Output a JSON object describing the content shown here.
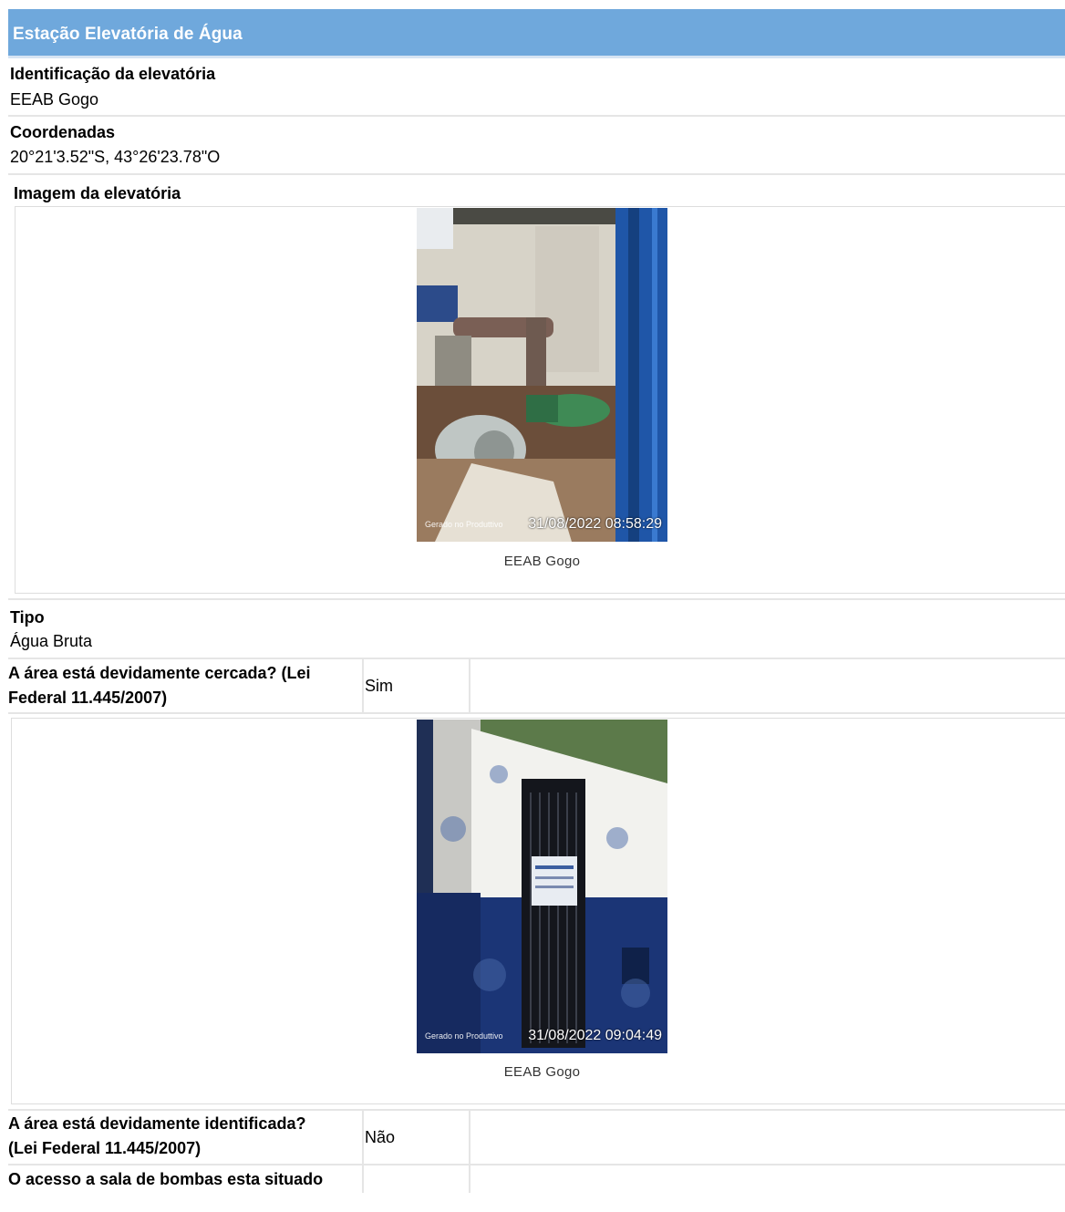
{
  "header": {
    "title": "Estação Elevatória de Água"
  },
  "identificacao": {
    "label": "Identificação da elevatória",
    "value": "EEAB Gogo"
  },
  "coordenadas": {
    "label": "Coordenadas",
    "value": "20°21'3.52\"S, 43°26'23.78\"O"
  },
  "imagem": {
    "label": "Imagem da elevatória",
    "photo_source": "Gerado no Produttivo",
    "photo_timestamp": "31/08/2022 08:58:29",
    "caption": "EEAB Gogo"
  },
  "tipo": {
    "label": "Tipo",
    "value": "Água Bruta"
  },
  "questions": [
    {
      "label_line1": "A área está devidamente cercada? (Lei",
      "label_line2": "Federal 11.445/2007)",
      "answer": "Sim",
      "photo_source": "Gerado no Produttivo",
      "photo_timestamp": "31/08/2022 09:04:49",
      "caption": "EEAB Gogo"
    },
    {
      "label_line1": "A área está devidamente identificada?",
      "label_line2": "(Lei Federal 11.445/2007)",
      "answer": "Não"
    },
    {
      "label_line1": "O acesso a sala de bombas esta situado"
    }
  ]
}
